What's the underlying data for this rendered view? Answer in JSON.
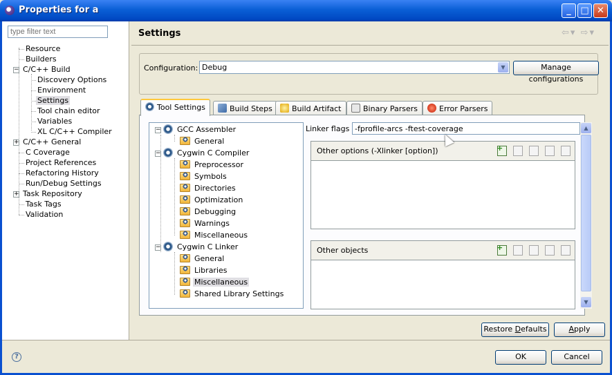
{
  "window": {
    "title": "Properties for a"
  },
  "left": {
    "filter_placeholder": "type filter text",
    "items": [
      {
        "label": "Resource"
      },
      {
        "label": "Builders"
      },
      {
        "label": "C/C++ Build"
      },
      {
        "label": "Discovery Options"
      },
      {
        "label": "Environment"
      },
      {
        "label": "Settings"
      },
      {
        "label": "Tool chain editor"
      },
      {
        "label": "Variables"
      },
      {
        "label": "XL C/C++ Compiler"
      },
      {
        "label": "C/C++ General"
      },
      {
        "label": "C Coverage"
      },
      {
        "label": "Project References"
      },
      {
        "label": "Refactoring History"
      },
      {
        "label": "Run/Debug Settings"
      },
      {
        "label": "Task Repository"
      },
      {
        "label": "Task Tags"
      },
      {
        "label": "Validation"
      }
    ]
  },
  "header": {
    "title": "Settings"
  },
  "config": {
    "label": "Configuration:",
    "value": "Debug",
    "manage_label": "Manage configurations"
  },
  "tabs": [
    {
      "label": "Tool Settings"
    },
    {
      "label": "Build Steps"
    },
    {
      "label": "Build Artifact"
    },
    {
      "label": "Binary Parsers"
    },
    {
      "label": "Error Parsers"
    }
  ],
  "tooltree": [
    {
      "label": "GCC Assembler"
    },
    {
      "label": "General"
    },
    {
      "label": "Cygwin C Compiler"
    },
    {
      "label": "Preprocessor"
    },
    {
      "label": "Symbols"
    },
    {
      "label": "Directories"
    },
    {
      "label": "Optimization"
    },
    {
      "label": "Debugging"
    },
    {
      "label": "Warnings"
    },
    {
      "label": "Miscellaneous"
    },
    {
      "label": "Cygwin C Linker"
    },
    {
      "label": "General"
    },
    {
      "label": "Libraries"
    },
    {
      "label": "Miscellaneous"
    },
    {
      "label": "Shared Library Settings"
    }
  ],
  "linker": {
    "flags_label": "Linker flags",
    "flags_value": "-fprofile-arcs -ftest-coverage",
    "other_options_title": "Other options (-Xlinker [option])",
    "other_objects_title": "Other objects"
  },
  "buttons": {
    "restore_pre": "Restore ",
    "restore_u": "D",
    "restore_post": "efaults",
    "apply_u": "A",
    "apply_post": "pply",
    "ok": "OK",
    "cancel": "Cancel"
  },
  "icons": {
    "help": "?"
  }
}
